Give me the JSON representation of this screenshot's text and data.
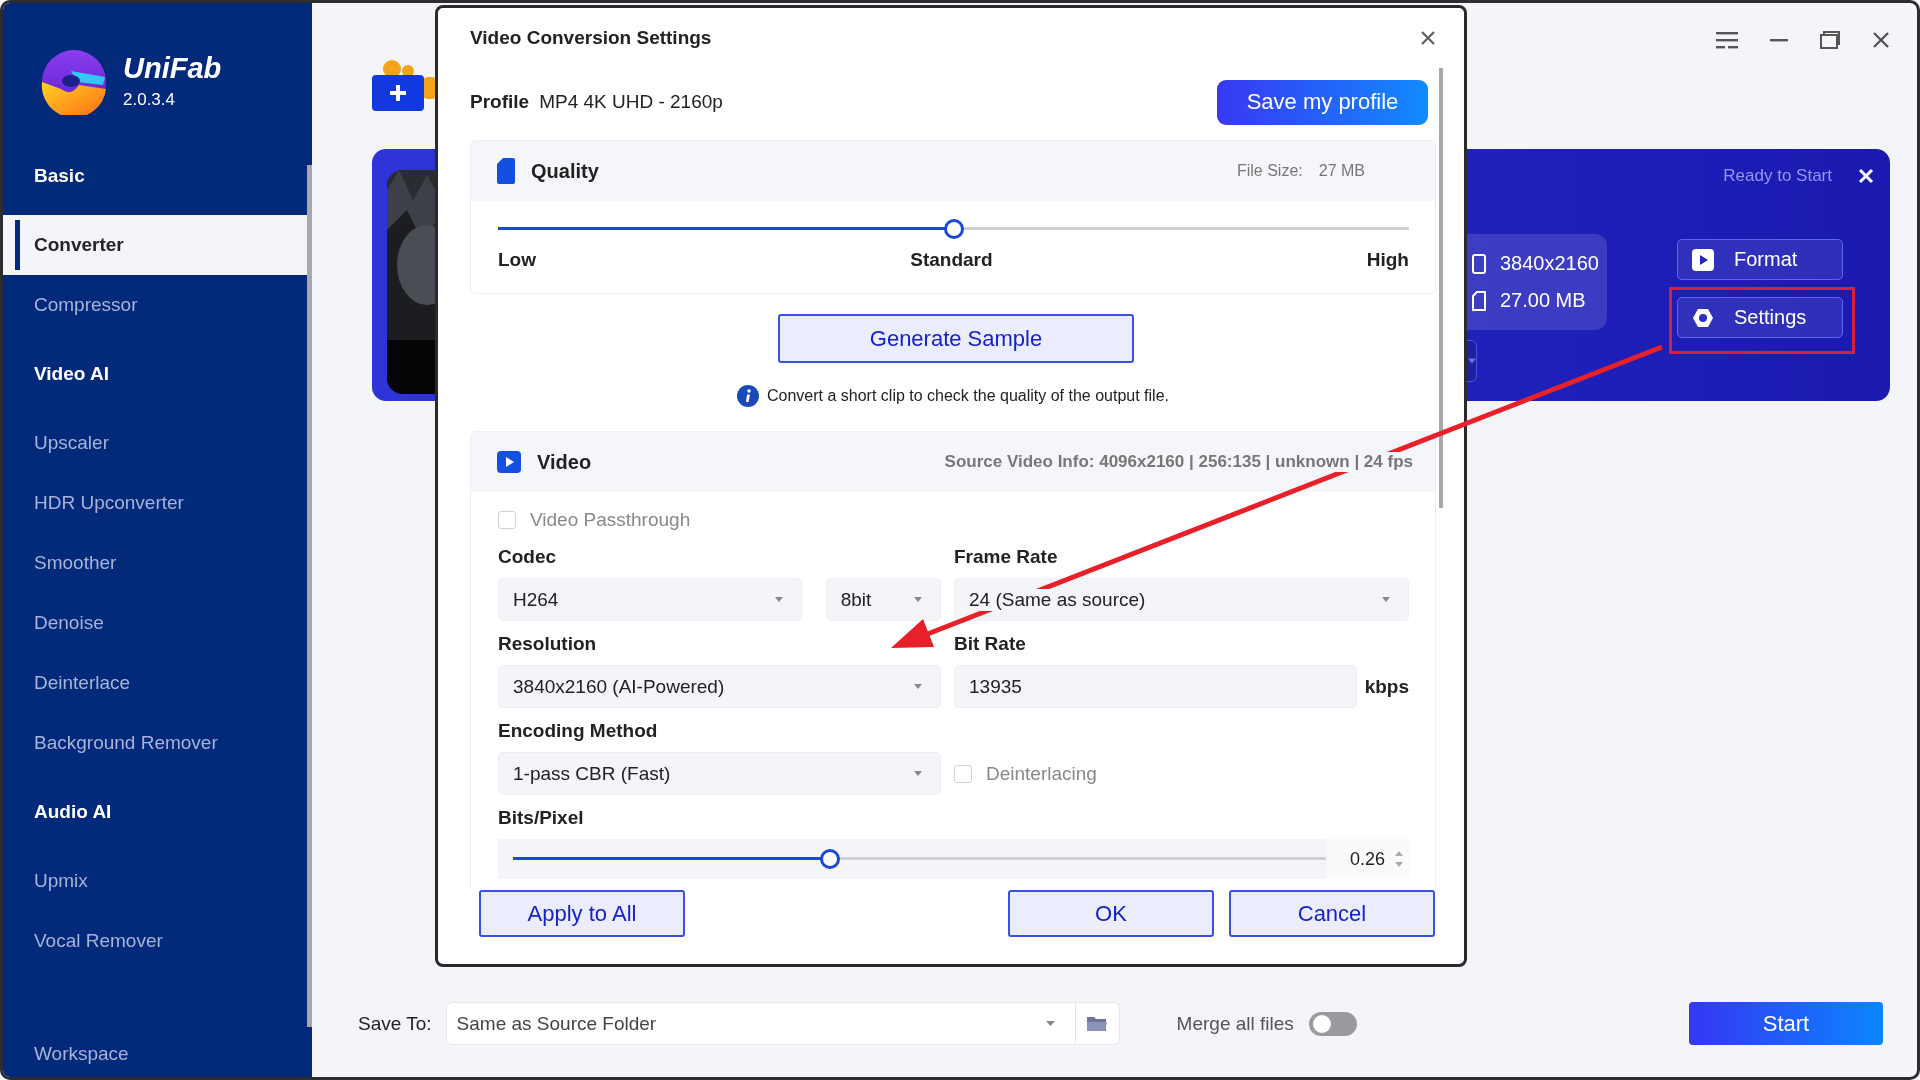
{
  "app": {
    "name": "UniFab",
    "version": "2.0.3.4"
  },
  "sidebar": {
    "sections": [
      {
        "title": "Basic",
        "items": [
          {
            "label": "Converter",
            "selected": true
          },
          {
            "label": "Compressor",
            "selected": false
          }
        ]
      },
      {
        "title": "Video AI",
        "items": [
          {
            "label": "Upscaler",
            "selected": false
          },
          {
            "label": "HDR Upconverter",
            "selected": false
          },
          {
            "label": "Smoother",
            "selected": false
          },
          {
            "label": "Denoise",
            "selected": false
          },
          {
            "label": "Deinterlace",
            "selected": false
          },
          {
            "label": "Background Remover",
            "selected": false
          }
        ]
      },
      {
        "title": "Audio AI",
        "items": [
          {
            "label": "Upmix",
            "selected": false
          },
          {
            "label": "Vocal Remover",
            "selected": false
          }
        ]
      }
    ],
    "footer": "Workspace"
  },
  "task": {
    "status": "Ready to Start",
    "resolution": "3840x2160",
    "size": "27.00 MB",
    "buttons": [
      {
        "label": "Format",
        "kind": "format",
        "highlighted": false
      },
      {
        "label": "Settings",
        "kind": "settings",
        "highlighted": true
      }
    ]
  },
  "dialog": {
    "title": "Video Conversion Settings",
    "profile_label": "Profile",
    "profile": "MP4 4K UHD - 2160p",
    "save_button": "Save my profile",
    "quality": {
      "title": "Quality",
      "file_size_label": "File Size:",
      "file_size": "27 MB",
      "level": 0.5,
      "labels": [
        "Low",
        "Standard",
        "High"
      ]
    },
    "sample_button": "Generate Sample",
    "sample_note": "Convert a short clip to check the quality of the output file.",
    "video": {
      "title": "Video",
      "source_info": "Source Video Info: 4096x2160 | 256:135 | unknown | 24 fps",
      "passthrough": {
        "label": "Video Passthrough",
        "checked": false
      },
      "codec": {
        "label": "Codec",
        "value": "H264",
        "depth": "8bit"
      },
      "frame_rate": {
        "label": "Frame Rate",
        "value": "24 (Same as source)"
      },
      "resolution": {
        "label": "Resolution",
        "value": "3840x2160 (AI-Powered)"
      },
      "bit_rate": {
        "label": "Bit Rate",
        "value": "13935",
        "unit": "kbps"
      },
      "encoding": {
        "label": "Encoding Method",
        "value": "1-pass CBR (Fast)"
      },
      "deinterlacing": {
        "label": "Deinterlacing",
        "checked": false
      },
      "bits_pixel": {
        "label": "Bits/Pixel",
        "level": 0.39,
        "value": "0.26"
      }
    },
    "buttons": [
      {
        "label": "Apply to All"
      },
      {
        "label": "OK"
      },
      {
        "label": "Cancel"
      }
    ]
  },
  "save_to": {
    "label": "Save To:",
    "value": "Same as Source Folder"
  },
  "merge": {
    "label": "Merge all files",
    "on": false
  },
  "start_button": "Start"
}
